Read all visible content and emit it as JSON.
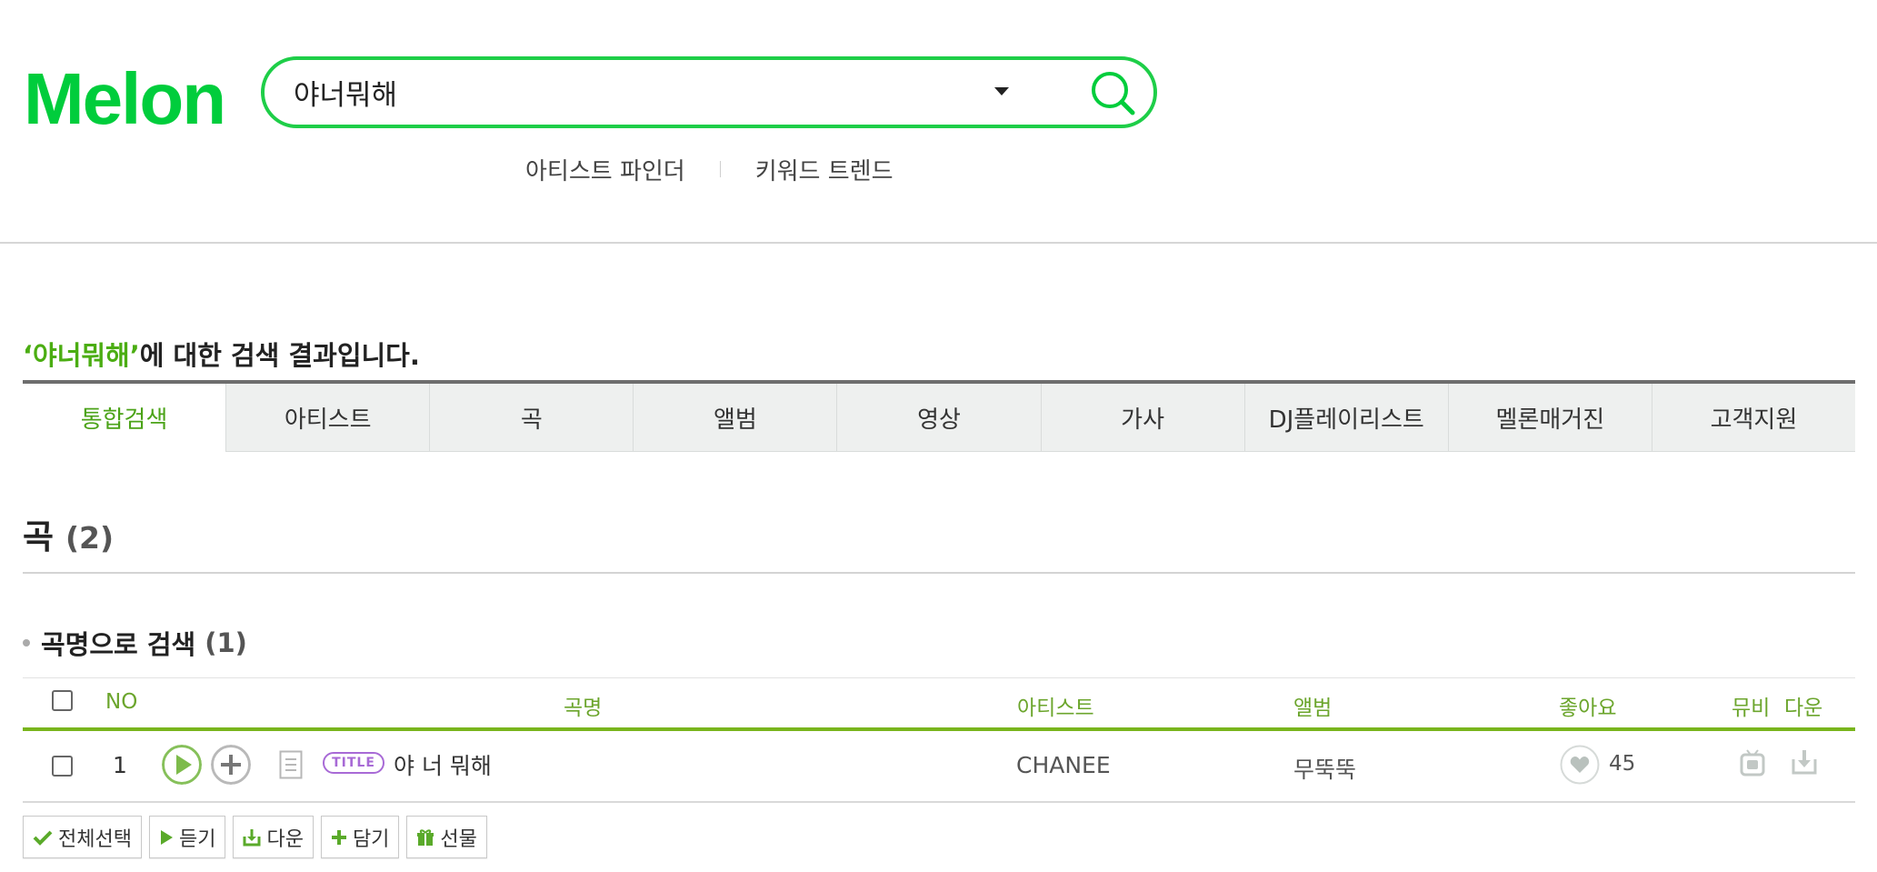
{
  "header": {
    "search_value": "야너뭐해",
    "links": [
      "아티스트 파인더",
      "키워드 트렌드"
    ]
  },
  "result_heading": {
    "keyword": "‘야너뭐해’",
    "suffix": "에 대한 검색 결과입니다."
  },
  "tabs": [
    "통합검색",
    "아티스트",
    "곡",
    "앨범",
    "영상",
    "가사",
    "DJ플레이리스트",
    "멜론매거진",
    "고객지원"
  ],
  "section": {
    "title": "곡",
    "count": "(2)"
  },
  "subsection": {
    "title": "곡명으로 검색",
    "count": "(1)"
  },
  "table": {
    "headers": {
      "no": "NO",
      "song": "곡명",
      "artist": "아티스트",
      "album": "앨범",
      "like": "좋아요",
      "mv": "뮤비",
      "down": "다운"
    },
    "rows": [
      {
        "no": "1",
        "badge": "TITLE",
        "song": "야 너 뭐해",
        "artist": "CHANEE",
        "album": "무뚝뚝",
        "likes": "45"
      }
    ]
  },
  "buttons": [
    "전체선택",
    "듣기",
    "다운",
    "담기",
    "선물"
  ],
  "colors": {
    "brand": "#00cd3c",
    "accent_green": "#4ba318",
    "title_badge": "#a86ad6"
  }
}
